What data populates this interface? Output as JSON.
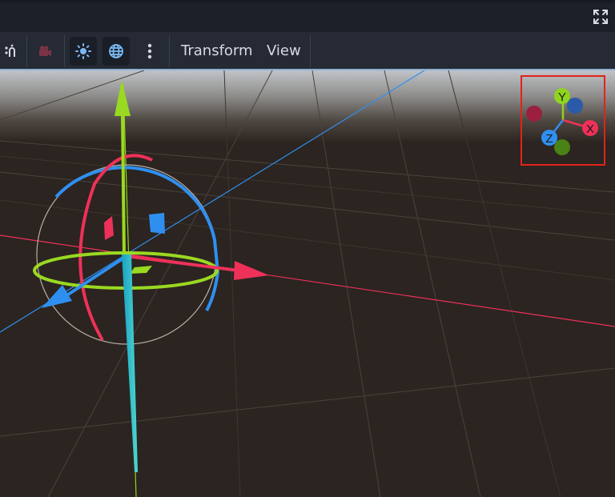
{
  "toolbar": {
    "menus": [
      {
        "label": "Transform"
      },
      {
        "label": "View"
      }
    ],
    "icons": [
      "select-mode-icon",
      "camera-icon",
      "sun-icon",
      "environment-icon",
      "more-options-icon"
    ]
  },
  "gizmo": {
    "labels": {
      "x": "X",
      "y": "Y",
      "z": "Z"
    }
  },
  "colors": {
    "titlebar": "#1c2029",
    "toolbar": "#252a35",
    "viewport_floor": "#2b2420",
    "axis_x": "#ee3158",
    "axis_y": "#8fd41e",
    "axis_z": "#2f8ff0",
    "highlight_box": "#e2231a"
  }
}
